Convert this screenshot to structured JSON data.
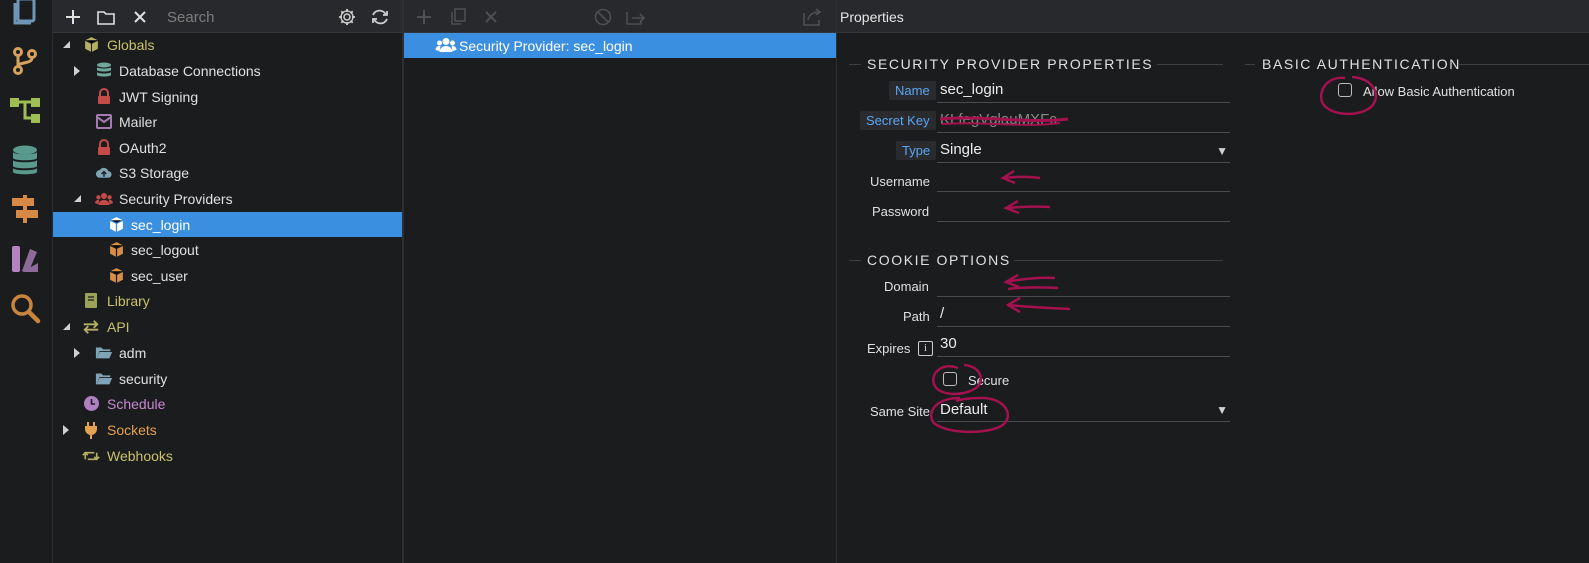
{
  "tree": {
    "search_placeholder": "Search",
    "items": [
      {
        "label": "Globals",
        "icon": "cube-icon"
      },
      {
        "label": "Database Connections",
        "icon": "database-icon"
      },
      {
        "label": "JWT Signing",
        "icon": "lock-icon"
      },
      {
        "label": "Mailer",
        "icon": "mail-icon"
      },
      {
        "label": "OAuth2",
        "icon": "lock-icon"
      },
      {
        "label": "S3 Storage",
        "icon": "cloud-upload-icon"
      },
      {
        "label": "Security Providers",
        "icon": "users-icon"
      },
      {
        "label": "sec_login",
        "icon": "cube-icon"
      },
      {
        "label": "sec_logout",
        "icon": "cube-icon"
      },
      {
        "label": "sec_user",
        "icon": "cube-icon"
      },
      {
        "label": "Library",
        "icon": "book-icon"
      },
      {
        "label": "API",
        "icon": "arrows-icon"
      },
      {
        "label": "adm",
        "icon": "folder-open-icon"
      },
      {
        "label": "security",
        "icon": "folder-open-icon"
      },
      {
        "label": "Schedule",
        "icon": "clock-icon"
      },
      {
        "label": "Sockets",
        "icon": "plug-icon"
      },
      {
        "label": "Webhooks",
        "icon": "retweet-icon"
      }
    ]
  },
  "middle": {
    "selected_item": "Security Provider: sec_login"
  },
  "properties": {
    "title": "Properties",
    "section_provider": "SECURITY PROVIDER PROPERTIES",
    "section_basic": "BASIC AUTHENTICATION",
    "section_cookie": "COOKIE OPTIONS",
    "name_label": "Name",
    "name_value": "sec_login",
    "secret_label": "Secret Key",
    "secret_value": "KLfegVglauMXFc",
    "type_label": "Type",
    "type_value": "Single",
    "username_label": "Username",
    "username_value": "",
    "password_label": "Password",
    "password_value": "",
    "domain_label": "Domain",
    "domain_value": "",
    "path_label": "Path",
    "path_value": "/",
    "expires_label": "Expires",
    "expires_value": "30",
    "info_glyph": "i",
    "secure_label": "Secure",
    "samesite_label": "Same Site",
    "samesite_value": "Default",
    "allow_basic_label": "Allow Basic Authentication"
  },
  "colors": {
    "selection": "#3b8fe0",
    "annotation": "#a3114f",
    "label_tag": "#5aa6f2"
  }
}
